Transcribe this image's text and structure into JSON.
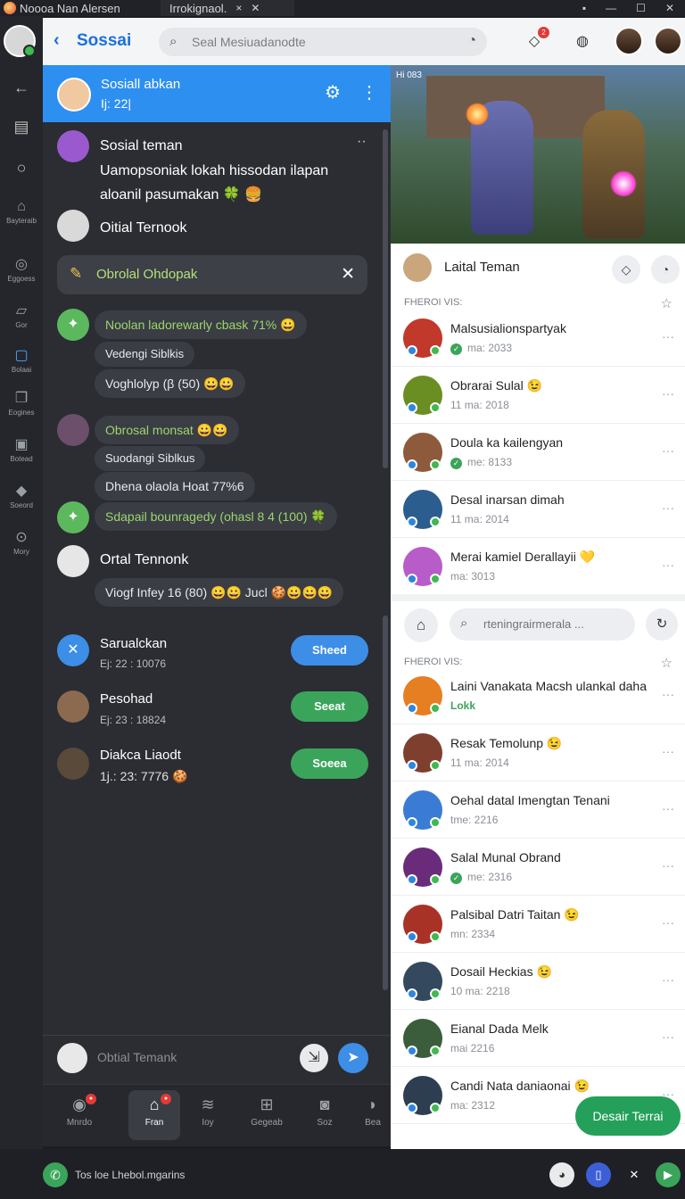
{
  "titlebar": {
    "app_title": "Noooa Nan Alersen",
    "tab2": "Irrokignaol.",
    "tab_close": "×",
    "tab_close2": "✕"
  },
  "header": {
    "back_icon": "‹",
    "title": "Sossai",
    "search_placeholder": "Seal Mesiuadanodte"
  },
  "rail": [
    {
      "label": "Bayteraib"
    },
    {
      "label": "Eggoess"
    },
    {
      "label": "Gor"
    },
    {
      "label": "Bolaai"
    },
    {
      "label": "Eogines"
    },
    {
      "label": "Botead"
    },
    {
      "label": "Soeord"
    },
    {
      "label": "Mory"
    }
  ],
  "group": {
    "name": "Sosiall abkan",
    "sub": "Ij: 22|"
  },
  "thread": {
    "first_sender": "Sosial teman",
    "first_line1": "Uamopsoniak lokah hissodan ilapan",
    "first_line2": "aloanil pasumakan 🍀 🍔",
    "second_sender": "Oitial Ternook",
    "pin_label": "Obrolal Ohdopak",
    "msg1": "Noolan ladorewarly cbask 71% 😀",
    "msg1_sub": "Vedengi Siblkis",
    "msg1_sub2": "Voghlolyp (β (50) 😀😀",
    "msg2": "Obrosal monsat 😀😀",
    "msg2_sub": "Suodangi Siblkus",
    "msg2_sub2": "Dhena olaola Hoat 77%6",
    "msg3": "Sdapail bounragedy (ohasl 8 4 (100) 🍀",
    "sender4": "Ortal Tennonk",
    "msg4": "Viogf Infey 16 (80) 😀😀  Jucl 🍪😀😀😀"
  },
  "invites": [
    {
      "name": "Sarualckan",
      "sub": "Ej: 22 : 10076",
      "btn": "Sheed"
    },
    {
      "name": "Pesohad",
      "sub": "Ej: 23 : 18824",
      "btn": "Seeat"
    },
    {
      "name": "Diakca Liaodt",
      "sub": "1j.: 23: 7776 🍪",
      "btn": "Soeea"
    }
  ],
  "composer": {
    "placeholder": "Obtial Temank"
  },
  "bottom_nav": [
    {
      "label": "Mnrdo"
    },
    {
      "label": "Fran"
    },
    {
      "label": "Ioy"
    },
    {
      "label": "Gegeab"
    },
    {
      "label": "Soz"
    },
    {
      "label": "Bea"
    }
  ],
  "statusbar": {
    "label": "Tos loe Lhebol.mgarins"
  },
  "video": {
    "hud": "Hi 083"
  },
  "right_header": {
    "title": "Laital Teman"
  },
  "section1": {
    "title": "FHEROI VIS:"
  },
  "friends": [
    {
      "name": "Malsusialionspartyak",
      "sub": "ma: 2033",
      "check": true,
      "color": "#c0392b"
    },
    {
      "name": "Obrarai Sulal 😉",
      "sub": "11 ma: 2018",
      "check": false,
      "color": "#6b8e23"
    },
    {
      "name": "Doula ka kailengyan",
      "sub": "me: 8133",
      "check": true,
      "color": "#8e5a3c"
    },
    {
      "name": "Desal inarsan dimah",
      "sub": "11 ma: 2014",
      "check": false,
      "color": "#2c5d8f"
    },
    {
      "name": "Merai kamiel Derallayii 💛",
      "sub": "ma: 3013",
      "check": false,
      "color": "#b85cc9"
    }
  ],
  "right_search": {
    "placeholder": "rteningrairmerala ..."
  },
  "section2": {
    "title": "FHEROI VIS:"
  },
  "friends2": [
    {
      "name": "Laini Vanakata Macsh ulankal daha",
      "sub": "Lokk",
      "check": false,
      "green": true,
      "color": "#e67e22"
    },
    {
      "name": "Resak Temolunp 😉",
      "sub": "11 ma: 2014",
      "check": false,
      "color": "#7f3f2f"
    },
    {
      "name": "Oehal datal Imengtan Tenani",
      "sub": "tme: 2216",
      "check": false,
      "color": "#3a7bd5"
    },
    {
      "name": "Salal Munal Obrand",
      "sub": "me: 2316",
      "check": true,
      "color": "#6a2c7a"
    },
    {
      "name": "Palsibal Datri Taitan 😉",
      "sub": "mn: 2334",
      "check": false,
      "color": "#a93226"
    },
    {
      "name": "Dosail Heckias 😉",
      "sub": "10 ma: 2218",
      "check": false,
      "color": "#34495e"
    },
    {
      "name": "Eianal Dada Melk",
      "sub": "mai 2216",
      "check": false,
      "color": "#3b5d3b"
    },
    {
      "name": "Candi Nata daniaonai 😉",
      "sub": "ma: 2312",
      "check": false,
      "color": "#2c3e50"
    }
  ],
  "fab": {
    "label": "Desair Terrai"
  }
}
